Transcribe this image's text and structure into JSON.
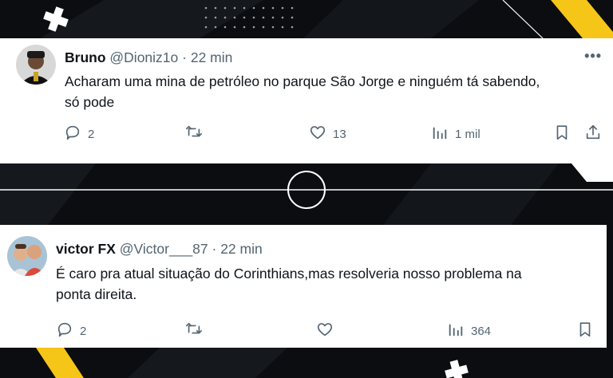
{
  "tweets": [
    {
      "name": "Bruno",
      "handle": "@Dioniz1o",
      "separator": "·",
      "time": "22 min",
      "text_line1": "Acharam uma mina de petróleo no parque São Jorge e ninguém tá sabendo,",
      "text_line2": "só pode",
      "replies": "2",
      "retweets": "",
      "likes": "13",
      "views": "1 mil",
      "more": "•••"
    },
    {
      "name": "victor FX",
      "handle": "@Victor___87",
      "separator": "·",
      "time": "22 min",
      "text_line1": "É caro pra atual situação do Corinthians,mas resolveria nosso problema na",
      "text_line2": "ponta direita.",
      "replies": "2",
      "retweets": "",
      "likes": "",
      "views": "364",
      "more": ""
    }
  ],
  "icons": {
    "reply": "reply-icon",
    "retweet": "retweet-icon",
    "like": "heart-icon",
    "views": "views-icon",
    "bookmark": "bookmark-icon",
    "share": "share-icon"
  },
  "colors": {
    "accent_yellow": "#f5c518",
    "text_primary": "#0f1419",
    "text_secondary": "#536471"
  }
}
